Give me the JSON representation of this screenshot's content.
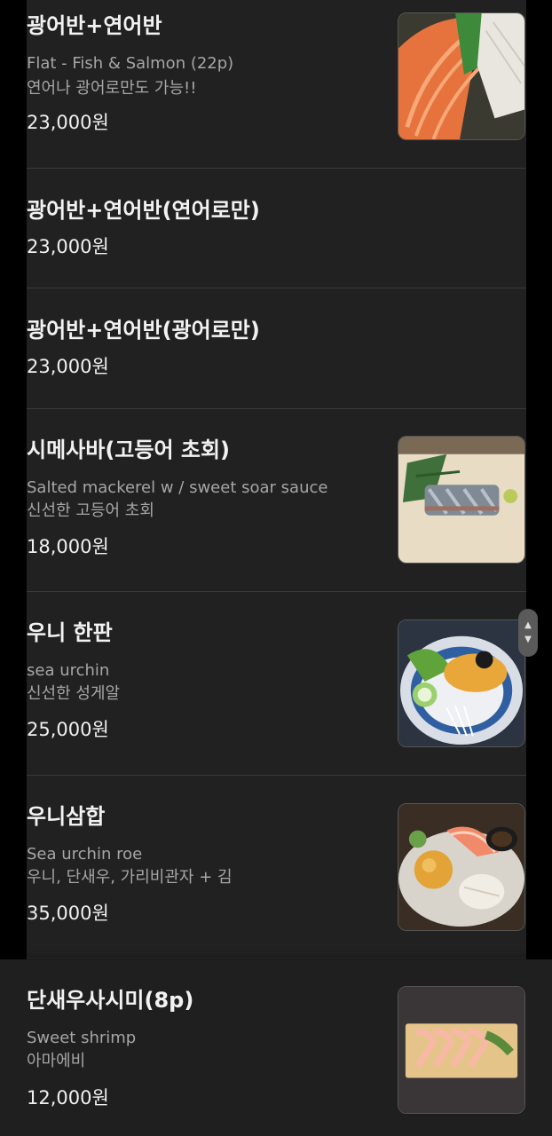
{
  "menu": {
    "items": [
      {
        "name": "광어반+연어반",
        "desc_en": "Flat - Fish & Salmon (22p)",
        "desc_ko": "연어나 광어로만도 가능!!",
        "price": "23,000원",
        "image_icon": "salmon-flatfish-sashimi-photo"
      },
      {
        "name": "광어반+연어반(연어로만)",
        "price": "23,000원"
      },
      {
        "name": "광어반+연어반(광어로만)",
        "price": "23,000원"
      },
      {
        "name": "시메사바(고등어 초회)",
        "desc_en": "Salted mackerel w / sweet soar sauce",
        "desc_ko": "신선한 고등어 초회",
        "price": "18,000원",
        "image_icon": "mackerel-sashimi-photo"
      },
      {
        "name": "우니 한판",
        "desc_en": "sea urchin",
        "desc_ko": "신선한 성게알",
        "price": "25,000원",
        "image_icon": "sea-urchin-photo"
      },
      {
        "name": "우니삼합",
        "desc_en": "Sea urchin roe",
        "desc_ko": "우니, 단새우, 가리비관자 + 김",
        "price": "35,000원",
        "image_icon": "sea-urchin-combo-photo"
      },
      {
        "name": "단새우사시미(8p)",
        "desc_en": "Sweet shrimp",
        "desc_ko": "아마에비",
        "price": "12,000원",
        "image_icon": "sweet-shrimp-photo"
      }
    ]
  },
  "scroll_handle": {
    "up_icon": "chevron-up-icon",
    "down_icon": "chevron-down-icon"
  },
  "colors": {
    "background": "#000000",
    "panel": "#212121",
    "text_primary": "#f2f2f2",
    "text_secondary": "#a6a6a6",
    "divider": "#3a3a3a"
  }
}
